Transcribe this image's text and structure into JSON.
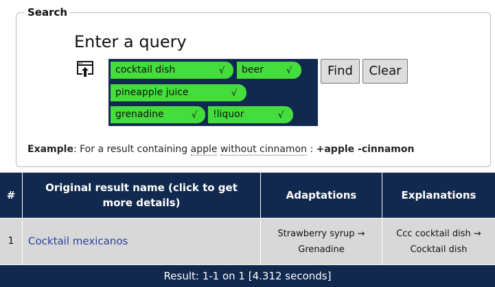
{
  "search": {
    "legend": "Search",
    "query_title": "Enter a query",
    "tags": [
      {
        "text": "cocktail dish",
        "check": "√"
      },
      {
        "text": "beer",
        "check": "√"
      },
      {
        "text": "pineapple juice",
        "check": "√"
      },
      {
        "text": "grenadine",
        "check": "√"
      },
      {
        "text": "!liquor",
        "check": "√"
      }
    ],
    "find_label": "Find",
    "clear_label": "Clear",
    "example": {
      "label": "Example",
      "text": ": For a result containing ",
      "word1": "apple",
      "word2": "without cinnamon",
      "sep": " : ",
      "code": "+apple -cinnamon"
    },
    "upload_icon": "upload-icon"
  },
  "results": {
    "headers": {
      "num": "#",
      "name": "Original result name (click to get more details)",
      "adaptations": "Adaptations",
      "explanations": "Explanations"
    },
    "rows": [
      {
        "num": "1",
        "name": "Cocktail mexicanos",
        "adaptation_line1": "Strawberry syrup →",
        "adaptation_line2": "Grenadine",
        "explanation_line1": "Ccc cocktail dish →",
        "explanation_line2": "Cocktail dish"
      }
    ],
    "footer": "Result: 1-1 on 1 [4.312 seconds]"
  },
  "colors": {
    "navy": "#12294f",
    "tag_green": "#44dd3c",
    "link_blue": "#2a3fa0",
    "row_gray": "#d8d8d8"
  }
}
